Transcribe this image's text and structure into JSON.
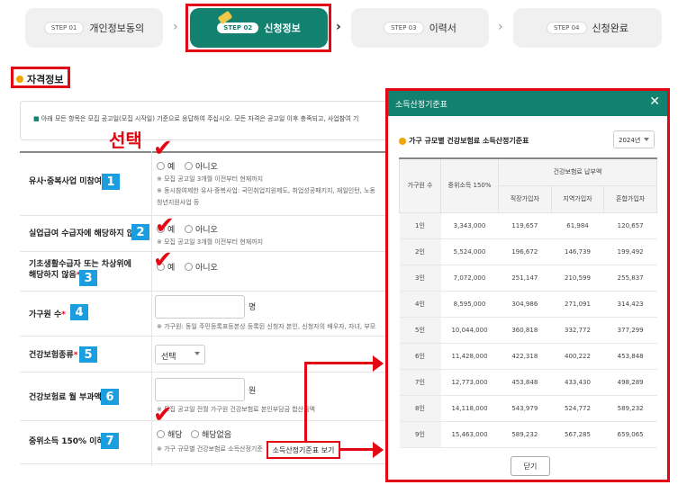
{
  "steps": [
    {
      "pill": "STEP 01",
      "label": "개인정보동의"
    },
    {
      "pill": "STEP 02",
      "label": "신청정보"
    },
    {
      "pill": "STEP 03",
      "label": "이력서"
    },
    {
      "pill": "STEP 04",
      "label": "신청완료"
    }
  ],
  "section_title": "자격정보",
  "notice": "아래 모든 항목은 모집 공고일(모집 시작일) 기준으로 응답하여 주십시오. 모든 자격은 공고일 이후 충족되고, 사업참여 기",
  "annotation_select": "선택",
  "form": {
    "row1": {
      "label": "유사·중복사업 미참여",
      "num": "1",
      "yes": "예",
      "no": "아니오",
      "hints": [
        "※ 모집 공고일 3개월 이전부터 현재까지",
        "※ 동시참여제한 유사·중복사업: 국민취업지원제도, 취업성공패키지, 재일인턴, 노동",
        "  청년지원사업 등"
      ]
    },
    "row2": {
      "label": "실업급여 수급자에 해당하지 않음",
      "num": "2",
      "yes": "예",
      "no": "아니오",
      "hint": "※ 모집 공고일 3개월 이전부터 현재까지"
    },
    "row3": {
      "label1": "기초생활수급자 또는 차상위에",
      "label2": "해당하지 않음",
      "num": "3",
      "yes": "예",
      "no": "아니오"
    },
    "row4": {
      "label": "가구원 수",
      "num": "4",
      "unit": "명",
      "hint": "※ 가구원: 동일 주민등록표등본상 등록된 신청자 본인, 신청자의 배우자, 자녀, 부모"
    },
    "row5": {
      "label": "건강보험종류",
      "num": "5",
      "select": "선택"
    },
    "row6": {
      "label": "건강보험료 월 부과액",
      "num": "6",
      "unit": "원",
      "hint": "※ 모집 공고일 전월 가구원 건강보험료 본인부담금 합산금액"
    },
    "row7": {
      "label": "중위소득 150% 이하",
      "num": "7",
      "yes": "해당",
      "no": "해당없음",
      "hint": "※ 가구 규모별 건강보험료 소득산정기준",
      "std_button": "소득산정기준표 보기"
    }
  },
  "modal": {
    "title": "소득산정기준표",
    "subtitle": "가구 규모별 건강보험료 소득산정기준표",
    "year": "2024년",
    "headers": {
      "members": "가구원 수",
      "median": "중위소득 150%",
      "premium": "건강보험료 납부액",
      "employee": "직장가입자",
      "regional": "지역가입자",
      "mixed": "혼합가입자"
    },
    "rows": [
      [
        "1인",
        "3,343,000",
        "119,657",
        "61,984",
        "120,657"
      ],
      [
        "2인",
        "5,524,000",
        "196,672",
        "146,739",
        "199,492"
      ],
      [
        "3인",
        "7,072,000",
        "251,147",
        "210,599",
        "255,837"
      ],
      [
        "4인",
        "8,595,000",
        "304,986",
        "271,091",
        "314,423"
      ],
      [
        "5인",
        "10,044,000",
        "360,818",
        "332,772",
        "377,299"
      ],
      [
        "6인",
        "11,428,000",
        "422,318",
        "400,222",
        "453,848"
      ],
      [
        "7인",
        "12,773,000",
        "453,848",
        "433,430",
        "498,289"
      ],
      [
        "8인",
        "14,118,000",
        "543,979",
        "524,772",
        "589,232"
      ],
      [
        "9인",
        "15,463,000",
        "589,232",
        "567,285",
        "659,065"
      ]
    ],
    "close": "닫기"
  },
  "colors": {
    "primary": "#13816f",
    "annotation": "#e30613",
    "badge": "#1a9ee0"
  }
}
